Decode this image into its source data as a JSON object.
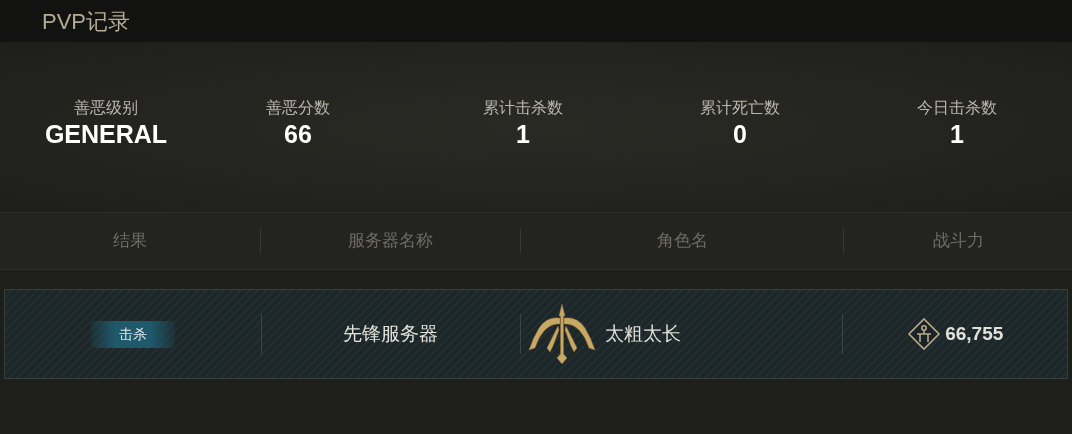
{
  "title": "PVP记录",
  "stats": [
    {
      "label": "善恶级别",
      "value": "GENERAL"
    },
    {
      "label": "善恶分数",
      "value": "66"
    },
    {
      "label": "累计击杀数",
      "value": "1"
    },
    {
      "label": "累计死亡数",
      "value": "0"
    },
    {
      "label": "今日击杀数",
      "value": "1"
    }
  ],
  "table": {
    "columns": [
      "结果",
      "服务器名称",
      "角色名",
      "战斗力"
    ],
    "rows": [
      {
        "result": {
          "text": "击杀",
          "kind": "kill"
        },
        "server": "先锋服务器",
        "character": "太粗太长",
        "power": "66,755"
      }
    ]
  }
}
